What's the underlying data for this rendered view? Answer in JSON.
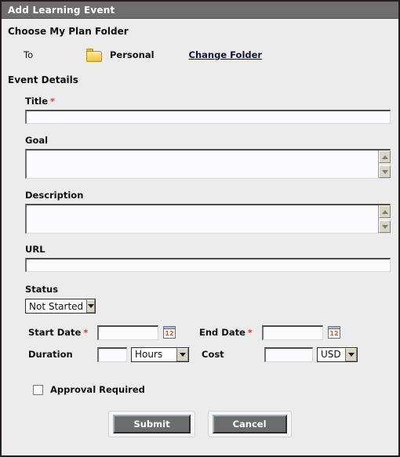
{
  "window": {
    "title": "Add Learning Event"
  },
  "folder_section": {
    "heading": "Choose My Plan Folder",
    "to_label": "To",
    "folder_icon": "folder-icon",
    "folder_name": "Personal",
    "change_link": "Change Folder"
  },
  "event_details": {
    "heading": "Event Details",
    "title": {
      "label": "Title",
      "required_marker": "*",
      "value": "",
      "placeholder": ""
    },
    "goal": {
      "label": "Goal",
      "value": "",
      "placeholder": ""
    },
    "description": {
      "label": "Description",
      "value": "",
      "placeholder": ""
    },
    "url": {
      "label": "URL",
      "value": "",
      "placeholder": ""
    },
    "status": {
      "label": "Status",
      "value": "Not Started",
      "options": [
        "Not Started"
      ]
    },
    "start_date": {
      "label": "Start Date",
      "required_marker": "*",
      "value": "",
      "calendar_icon": "calendar-icon",
      "calendar_day": "12"
    },
    "end_date": {
      "label": "End Date",
      "required_marker": "*",
      "value": "",
      "calendar_icon": "calendar-icon",
      "calendar_day": "12"
    },
    "duration": {
      "label": "Duration",
      "value": "",
      "unit": "Hours",
      "unit_options": [
        "Hours"
      ]
    },
    "cost": {
      "label": "Cost",
      "value": "",
      "currency": "USD",
      "currency_options": [
        "USD"
      ]
    },
    "approval": {
      "label": "Approval Required",
      "checked": false
    }
  },
  "actions": {
    "submit_label": "Submit",
    "cancel_label": "Cancel"
  },
  "colors": {
    "titlebar_bg": "#6e6e6e",
    "page_bg": "#ececec",
    "required_red": "#e03a12",
    "link_color": "#12123c",
    "button_bg": "#6c6c6c",
    "folder_yellow": "#f0c93f"
  }
}
